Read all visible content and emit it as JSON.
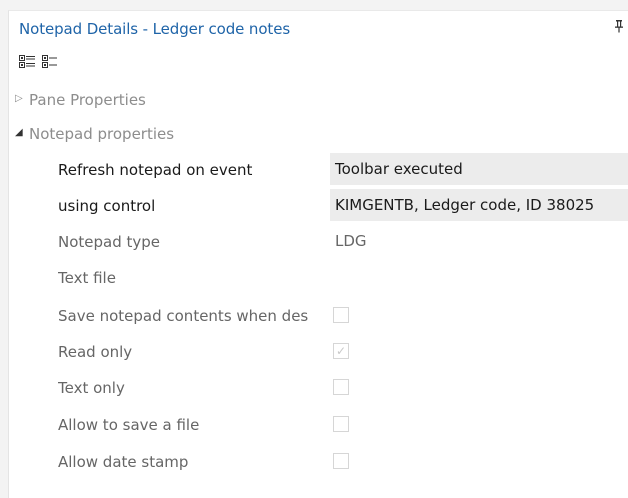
{
  "title": "Notepad Details - Ledger code notes",
  "pin_icon": "pin-icon",
  "toolbar": {
    "icons": [
      "categorized-view-icon",
      "alphabetical-view-icon"
    ],
    "dropdown_icon": "chevron-down-icon"
  },
  "sections": {
    "pane": {
      "label": "Pane Properties",
      "expanded": false
    },
    "notepad": {
      "label": "Notepad properties",
      "expanded": true
    }
  },
  "properties": {
    "refresh": {
      "name": "Refresh notepad on event",
      "value": "Toolbar executed"
    },
    "control": {
      "name": "using control",
      "value": "KIMGENTB, Ledger code, ID 38025"
    },
    "type": {
      "name": "Notepad type",
      "value": "LDG"
    },
    "textfile": {
      "name": "Text file",
      "value": ""
    },
    "save": {
      "name": "Save notepad contents when des",
      "checked": false
    },
    "readonly": {
      "name": "Read only",
      "checked": true,
      "check_glyph": "✓"
    },
    "textonly": {
      "name": "Text only",
      "checked": false
    },
    "allowsave": {
      "name": "Allow to save a file",
      "checked": false
    },
    "datestamp": {
      "name": "Allow date stamp",
      "checked": false
    }
  },
  "colors": {
    "title": "#1f64a8",
    "combo_bg": "#ececec"
  }
}
